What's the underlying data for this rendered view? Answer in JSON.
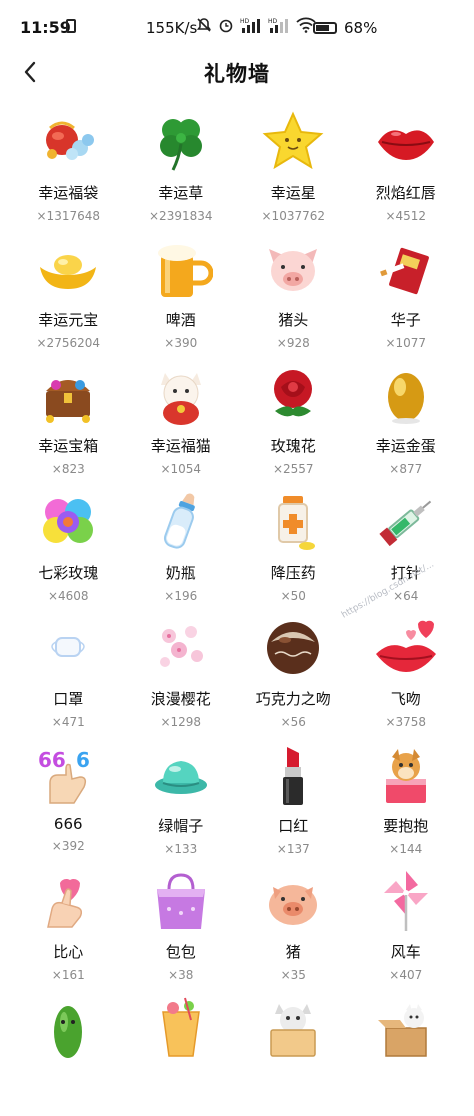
{
  "status_bar": {
    "time": "11:59",
    "network_speed": "155K/s",
    "battery_percent": "68%",
    "icons": [
      "sim-icon",
      "mute-icon",
      "alarm-icon",
      "hd-signal-icon",
      "hd-signal-icon",
      "wifi-icon",
      "battery-icon"
    ]
  },
  "header": {
    "title": "礼物墙",
    "back_icon": "back-arrow-icon"
  },
  "gifts": [
    {
      "name": "幸运福袋",
      "count": "×1317648",
      "icon": "lucky-bag-icon"
    },
    {
      "name": "幸运草",
      "count": "×2391834",
      "icon": "clover-icon"
    },
    {
      "name": "幸运星",
      "count": "×1037762",
      "icon": "star-icon"
    },
    {
      "name": "烈焰红唇",
      "count": "×4512",
      "icon": "red-lips-icon"
    },
    {
      "name": "幸运元宝",
      "count": "×2756204",
      "icon": "gold-ingot-icon"
    },
    {
      "name": "啤酒",
      "count": "×390",
      "icon": "beer-icon"
    },
    {
      "name": "猪头",
      "count": "×928",
      "icon": "pig-head-icon"
    },
    {
      "name": "华子",
      "count": "×1077",
      "icon": "cigarette-icon"
    },
    {
      "name": "幸运宝箱",
      "count": "×823",
      "icon": "treasure-chest-icon"
    },
    {
      "name": "幸运福猫",
      "count": "×1054",
      "icon": "lucky-cat-icon"
    },
    {
      "name": "玫瑰花",
      "count": "×2557",
      "icon": "rose-icon"
    },
    {
      "name": "幸运金蛋",
      "count": "×877",
      "icon": "golden-egg-icon"
    },
    {
      "name": "七彩玫瑰",
      "count": "×4608",
      "icon": "rainbow-rose-icon"
    },
    {
      "name": "奶瓶",
      "count": "×196",
      "icon": "baby-bottle-icon"
    },
    {
      "name": "降压药",
      "count": "×50",
      "icon": "medicine-icon"
    },
    {
      "name": "打针",
      "count": "×64",
      "icon": "syringe-icon"
    },
    {
      "name": "口罩",
      "count": "×471",
      "icon": "mask-icon"
    },
    {
      "name": "浪漫樱花",
      "count": "×1298",
      "icon": "cherry-blossom-icon"
    },
    {
      "name": "巧克力之吻",
      "count": "×56",
      "icon": "chocolate-icon"
    },
    {
      "name": "飞吻",
      "count": "×3758",
      "icon": "flying-kiss-icon"
    },
    {
      "name": "666",
      "count": "×392",
      "icon": "hand-666-icon"
    },
    {
      "name": "绿帽子",
      "count": "×133",
      "icon": "green-hat-icon"
    },
    {
      "name": "口红",
      "count": "×137",
      "icon": "lipstick-icon"
    },
    {
      "name": "要抱抱",
      "count": "×144",
      "icon": "hug-dog-icon"
    },
    {
      "name": "比心",
      "count": "×161",
      "icon": "finger-heart-icon"
    },
    {
      "name": "包包",
      "count": "×38",
      "icon": "handbag-icon"
    },
    {
      "name": "猪",
      "count": "×35",
      "icon": "pig-icon"
    },
    {
      "name": "风车",
      "count": "×407",
      "icon": "pinwheel-icon"
    },
    {
      "name": "",
      "count": "",
      "icon": "cucumber-icon"
    },
    {
      "name": "",
      "count": "",
      "icon": "drink-icon"
    },
    {
      "name": "",
      "count": "",
      "icon": "cat-sign-icon"
    },
    {
      "name": "",
      "count": "",
      "icon": "cat-box-icon"
    }
  ],
  "watermark": "https://blog.csdn.net/..."
}
